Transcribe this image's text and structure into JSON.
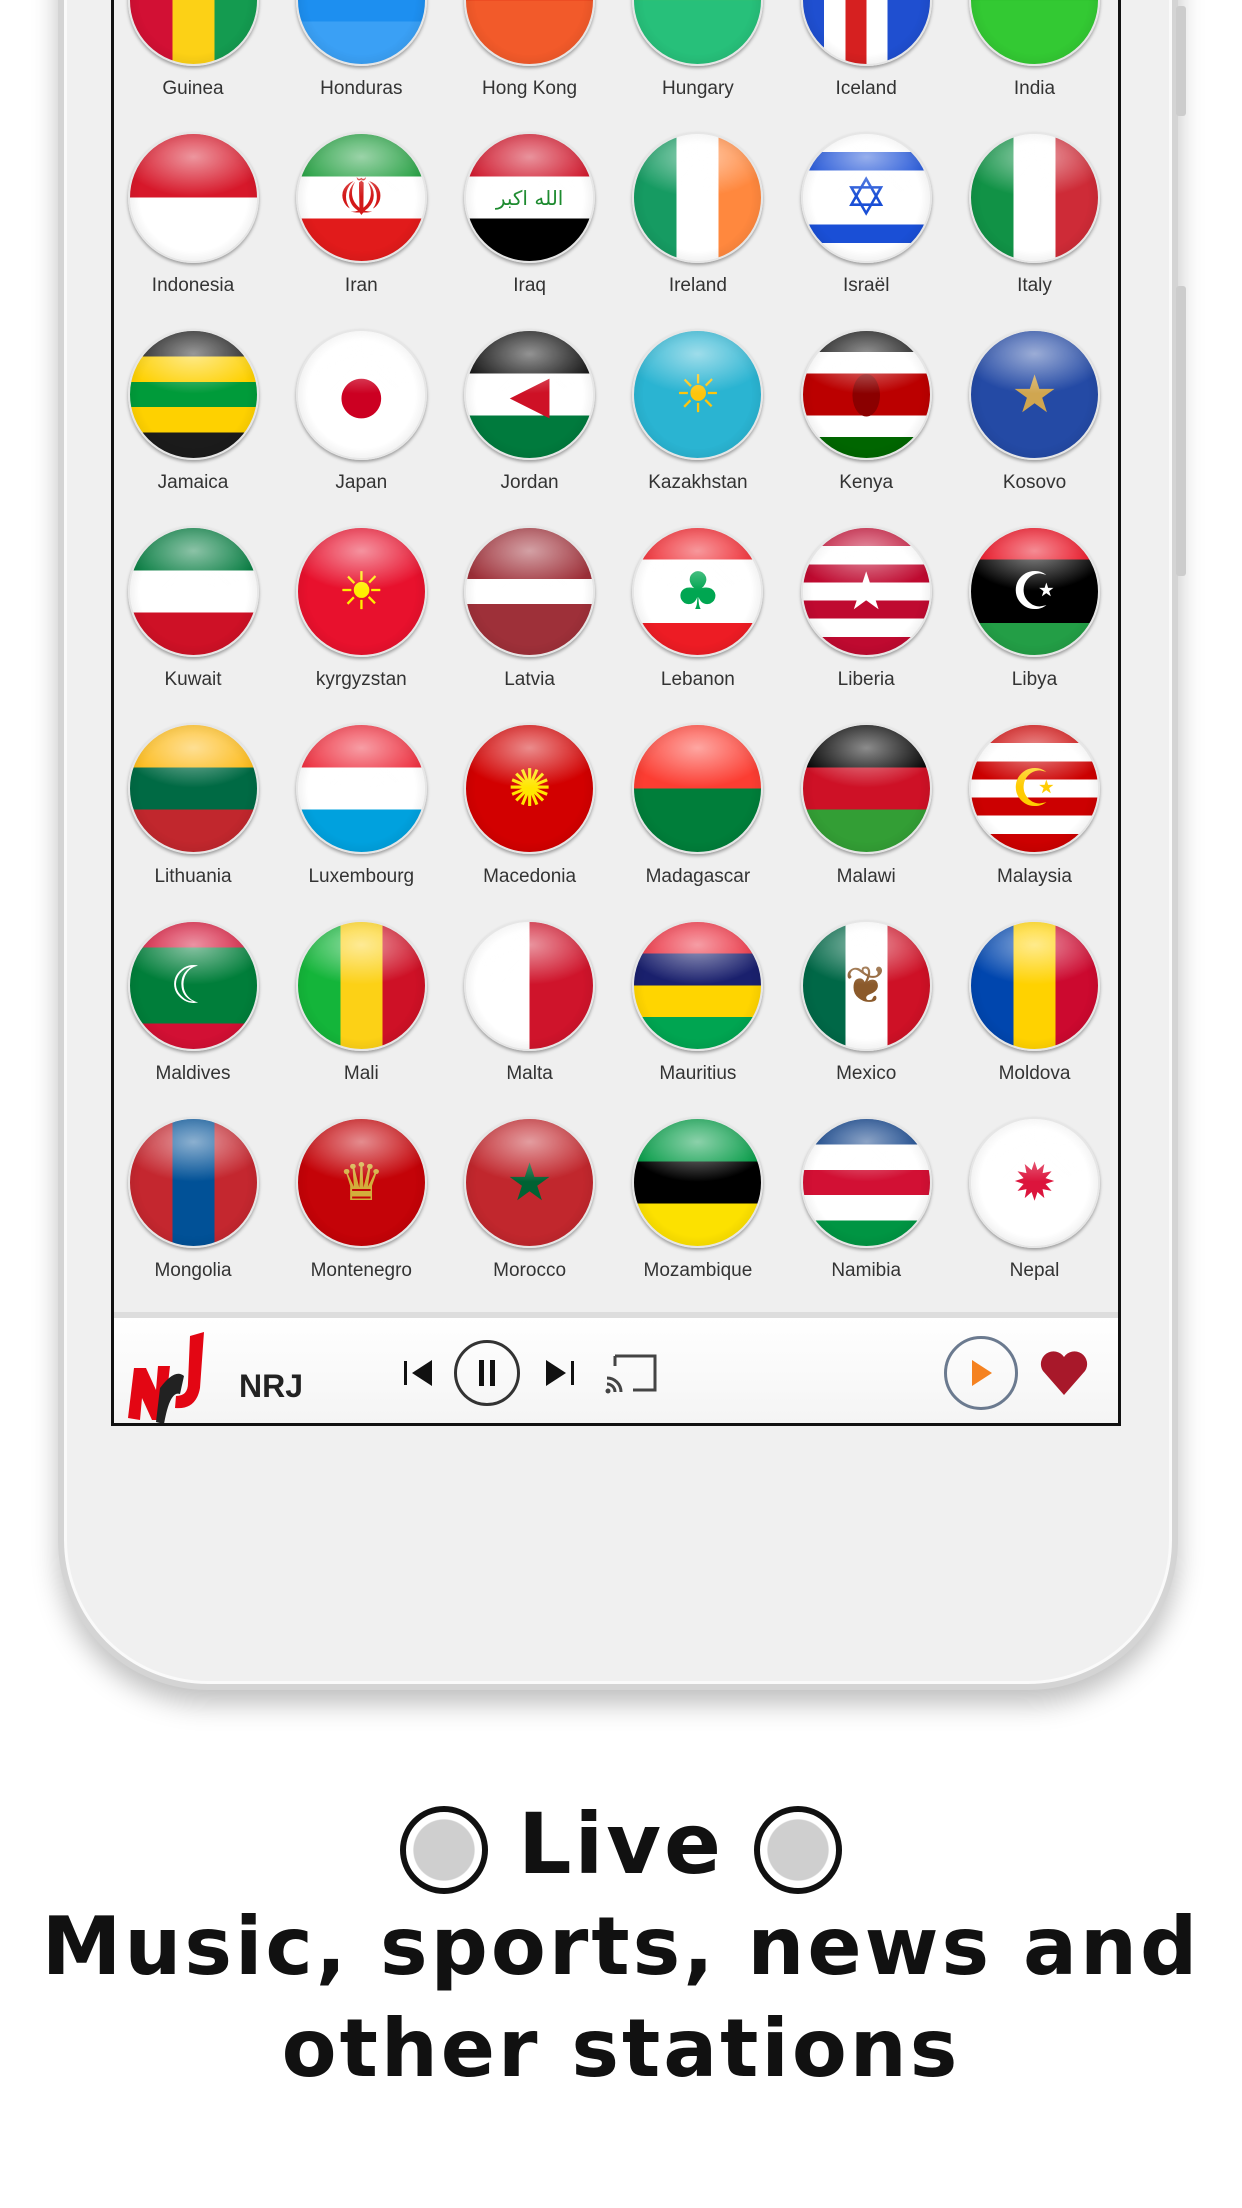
{
  "countries": [
    {
      "name": "Guinea",
      "dir": "v",
      "stripes": [
        "#d21034",
        "#fcd116",
        "#149b50"
      ]
    },
    {
      "name": "Honduras",
      "dir": "h",
      "stripes": [
        "#1d6be0",
        "#1d8ff0",
        "#3aa0f5"
      ]
    },
    {
      "name": "Hong Kong",
      "dir": "h",
      "stripes": [
        "#e8401c",
        "#f25a2a"
      ]
    },
    {
      "name": "Hungary",
      "dir": "h",
      "stripes": [
        "#2fbf71",
        "#27c07a"
      ]
    },
    {
      "name": "Iceland",
      "dir": "v",
      "stripes": [
        "#1f4fd0",
        "#fff",
        "#d62020",
        "#fff",
        "#1f4fd0",
        "#1f4fd0"
      ]
    },
    {
      "name": "India",
      "dir": "h",
      "stripes": [
        "#2fc22f",
        "#33c933"
      ]
    },
    {
      "name": "Indonesia",
      "dir": "h",
      "stripes": [
        "#d7182a",
        "#ffffff"
      ]
    },
    {
      "name": "Iran",
      "dir": "h",
      "stripes": [
        "#239f40",
        "#ffffff",
        "#e11b1b"
      ],
      "emblem": "☫",
      "emblem_color": "#d31818"
    },
    {
      "name": "Iraq",
      "dir": "h",
      "stripes": [
        "#ce1126",
        "#ffffff",
        "#000000"
      ],
      "emblem": "الله اكبر",
      "emblem_color": "#1c8a2e"
    },
    {
      "name": "Ireland",
      "dir": "v",
      "stripes": [
        "#169b62",
        "#ffffff",
        "#ff883e"
      ]
    },
    {
      "name": "Israël",
      "dir": "h",
      "stripes": [
        "#fff",
        "#1a4fd6",
        "#fff",
        "#fff",
        "#fff",
        "#1a4fd6",
        "#fff"
      ],
      "emblem": "✡",
      "emblem_color": "#1a4fd6"
    },
    {
      "name": "Italy",
      "dir": "v",
      "stripes": [
        "#119246",
        "#ffffff",
        "#ce2b37"
      ]
    },
    {
      "name": "Jamaica",
      "dir": "h",
      "stripes": [
        "#1b1b1b",
        "#fed100",
        "#009b3a",
        "#fed100",
        "#1b1b1b"
      ]
    },
    {
      "name": "Japan",
      "dir": "h",
      "stripes": [
        "#ffffff"
      ],
      "emblem": "●",
      "emblem_color": "#cc0022"
    },
    {
      "name": "Jordan",
      "dir": "h",
      "stripes": [
        "#111111",
        "#ffffff",
        "#007a3d"
      ],
      "emblem": "◀",
      "emblem_color": "#ce1126"
    },
    {
      "name": "Kazakhstan",
      "dir": "h",
      "stripes": [
        "#2ab4d2"
      ],
      "emblem": "☀",
      "emblem_color": "#fec50c"
    },
    {
      "name": "Kenya",
      "dir": "h",
      "stripes": [
        "#111111",
        "#fff",
        "#bb0000",
        "#bb0000",
        "#fff",
        "#006600"
      ],
      "emblem": "⬮",
      "emblem_color": "#8b0000"
    },
    {
      "name": "Kosovo",
      "dir": "h",
      "stripes": [
        "#244aa5"
      ],
      "emblem": "★",
      "emblem_color": "#d0a650"
    },
    {
      "name": "Kuwait",
      "dir": "h",
      "stripes": [
        "#007a3d",
        "#ffffff",
        "#ce1126"
      ]
    },
    {
      "name": "kyrgyzstan",
      "dir": "h",
      "stripes": [
        "#e8112d"
      ],
      "emblem": "☀",
      "emblem_color": "#ffef00"
    },
    {
      "name": "Latvia",
      "dir": "h",
      "stripes": [
        "#9e3039",
        "#9e3039",
        "#ffffff",
        "#9e3039",
        "#9e3039"
      ]
    },
    {
      "name": "Lebanon",
      "dir": "h",
      "stripes": [
        "#ed1c24",
        "#ffffff",
        "#ffffff",
        "#ed1c24"
      ],
      "emblem": "♣",
      "emblem_color": "#00a651"
    },
    {
      "name": "Liberia",
      "dir": "h",
      "stripes": [
        "#bf0a30",
        "#fff",
        "#bf0a30",
        "#fff",
        "#bf0a30",
        "#fff",
        "#bf0a30"
      ],
      "emblem": "★",
      "emblem_color": "#ffffff"
    },
    {
      "name": "Libya",
      "dir": "h",
      "stripes": [
        "#e70013",
        "#000000",
        "#000000",
        "#239e46"
      ],
      "emblem": "☪",
      "emblem_color": "#ffffff"
    },
    {
      "name": "Lithuania",
      "dir": "h",
      "stripes": [
        "#fdb913",
        "#006a44",
        "#c1272d"
      ]
    },
    {
      "name": "Luxembourg",
      "dir": "h",
      "stripes": [
        "#ed2939",
        "#ffffff",
        "#00a1de"
      ]
    },
    {
      "name": "Macedonia",
      "dir": "h",
      "stripes": [
        "#d20000"
      ],
      "emblem": "✺",
      "emblem_color": "#ffe600"
    },
    {
      "name": "Madagascar",
      "dir": "h",
      "stripes": [
        "#fc3d32",
        "#007e3a"
      ]
    },
    {
      "name": "Malawi",
      "dir": "h",
      "stripes": [
        "#000000",
        "#ce1126",
        "#339e35"
      ]
    },
    {
      "name": "Malaysia",
      "dir": "h",
      "stripes": [
        "#cc0001",
        "#fff",
        "#cc0001",
        "#fff",
        "#cc0001",
        "#fff",
        "#cc0001"
      ],
      "emblem": "☪",
      "emblem_color": "#ffcc00"
    },
    {
      "name": "Maldives",
      "dir": "h",
      "stripes": [
        "#d21034",
        "#007e3a",
        "#007e3a",
        "#007e3a",
        "#d21034"
      ],
      "emblem": "☾",
      "emblem_color": "#ffffff"
    },
    {
      "name": "Mali",
      "dir": "v",
      "stripes": [
        "#14b53a",
        "#fcd116",
        "#ce1126"
      ]
    },
    {
      "name": "Malta",
      "dir": "v",
      "stripes": [
        "#ffffff",
        "#cf142b"
      ]
    },
    {
      "name": "Mauritius",
      "dir": "h",
      "stripes": [
        "#ea2839",
        "#1a206d",
        "#ffd500",
        "#00a551"
      ]
    },
    {
      "name": "Mexico",
      "dir": "v",
      "stripes": [
        "#006847",
        "#ffffff",
        "#ce1126"
      ],
      "emblem": "❦",
      "emblem_color": "#8b5a2b"
    },
    {
      "name": "Moldova",
      "dir": "v",
      "stripes": [
        "#0046ae",
        "#ffd200",
        "#cc092f"
      ]
    },
    {
      "name": "Mongolia",
      "dir": "v",
      "stripes": [
        "#c4272f",
        "#015197",
        "#c4272f"
      ]
    },
    {
      "name": "Montenegro",
      "dir": "h",
      "stripes": [
        "#c40308"
      ],
      "emblem": "♛",
      "emblem_color": "#d3ae3b"
    },
    {
      "name": "Morocco",
      "dir": "h",
      "stripes": [
        "#c1272d"
      ],
      "emblem": "★",
      "emblem_color": "#006233"
    },
    {
      "name": "Mozambique",
      "dir": "h",
      "stripes": [
        "#009a44",
        "#000000",
        "#fce100"
      ]
    },
    {
      "name": "Namibia",
      "dir": "h",
      "stripes": [
        "#003580",
        "#ffffff",
        "#d21034",
        "#ffffff",
        "#009543"
      ]
    },
    {
      "name": "Nepal",
      "dir": "h",
      "stripes": [
        "#ffffff"
      ],
      "emblem": "✹",
      "emblem_color": "#dc143c"
    },
    {
      "name": "",
      "dir": "h",
      "stripes": [
        "#d63b3b"
      ]
    },
    {
      "name": "",
      "dir": "h",
      "stripes": [
        "#1f3f8f"
      ]
    },
    {
      "name": "",
      "dir": "h",
      "stripes": [
        "#3d8be0"
      ]
    },
    {
      "name": "",
      "dir": "v",
      "stripes": [
        "#1f9a3c",
        "#ffffff",
        "#1f9a3c"
      ]
    },
    {
      "name": "",
      "dir": "v",
      "stripes": [
        "#d22030",
        "#fff",
        "#1f3a8f",
        "#fff",
        "#d22030"
      ]
    },
    {
      "name": "",
      "dir": "h",
      "stripes": [
        "#ffffff",
        "#e86a6a"
      ]
    }
  ],
  "player": {
    "station": "NRJ",
    "logo_text": "NRJ",
    "accent": "#f58220",
    "heart_color": "#a8182a"
  },
  "footer": {
    "line1": "Live",
    "line2": "Music, sports, news and",
    "line3": "other stations"
  }
}
